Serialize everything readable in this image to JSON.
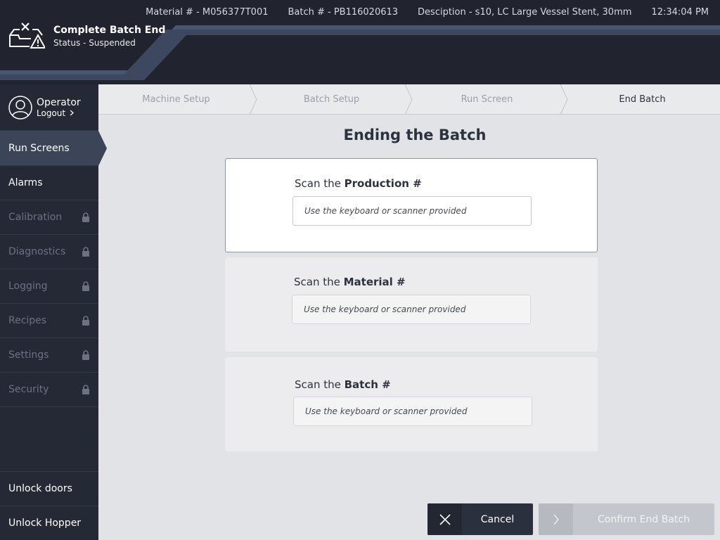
{
  "header": {
    "title": "Complete Batch End",
    "status": "Status - Suspended",
    "material": "Material # - M056377T001",
    "batch": "Batch # - PB116020613",
    "description": "Desciption - s10, LC Large Vessel Stent, 30mm",
    "time": "12:34:04 PM"
  },
  "operator": {
    "name": "Operator",
    "logout": "Logout"
  },
  "sidebar": {
    "items": [
      {
        "label": "Run Screens",
        "state": "active"
      },
      {
        "label": "Alarms",
        "state": "enabled"
      },
      {
        "label": "Calibration",
        "state": "locked"
      },
      {
        "label": "Diagnostics",
        "state": "locked"
      },
      {
        "label": "Logging",
        "state": "locked"
      },
      {
        "label": "Recipes",
        "state": "locked"
      },
      {
        "label": "Settings",
        "state": "locked"
      },
      {
        "label": "Security",
        "state": "locked"
      }
    ],
    "bottom": [
      {
        "label": "Unlock doors"
      },
      {
        "label": "Unlock Hopper"
      }
    ]
  },
  "steps": [
    {
      "label": "Machine Setup"
    },
    {
      "label": "Batch Setup"
    },
    {
      "label": "Run Screen"
    },
    {
      "label": "End Batch"
    }
  ],
  "main": {
    "title": "Ending the Batch",
    "scans": [
      {
        "prefix": "Scan the ",
        "field": "Production #",
        "placeholder": "Use the keyboard or scanner provided",
        "value": ""
      },
      {
        "prefix": "Scan the ",
        "field": "Material #",
        "placeholder": "Use the keyboard or scanner provided",
        "value": ""
      },
      {
        "prefix": "Scan the ",
        "field": "Batch #",
        "placeholder": "Use the keyboard or scanner provided",
        "value": ""
      }
    ]
  },
  "buttons": {
    "cancel": "Cancel",
    "confirm": "Confirm End Batch"
  },
  "colors": {
    "header_bg": "#21242e",
    "sidebar_bg": "#252935",
    "active_nav": "#3c4557",
    "accent_stripe": "#4a5670",
    "content_bg": "#e2e3e6"
  }
}
